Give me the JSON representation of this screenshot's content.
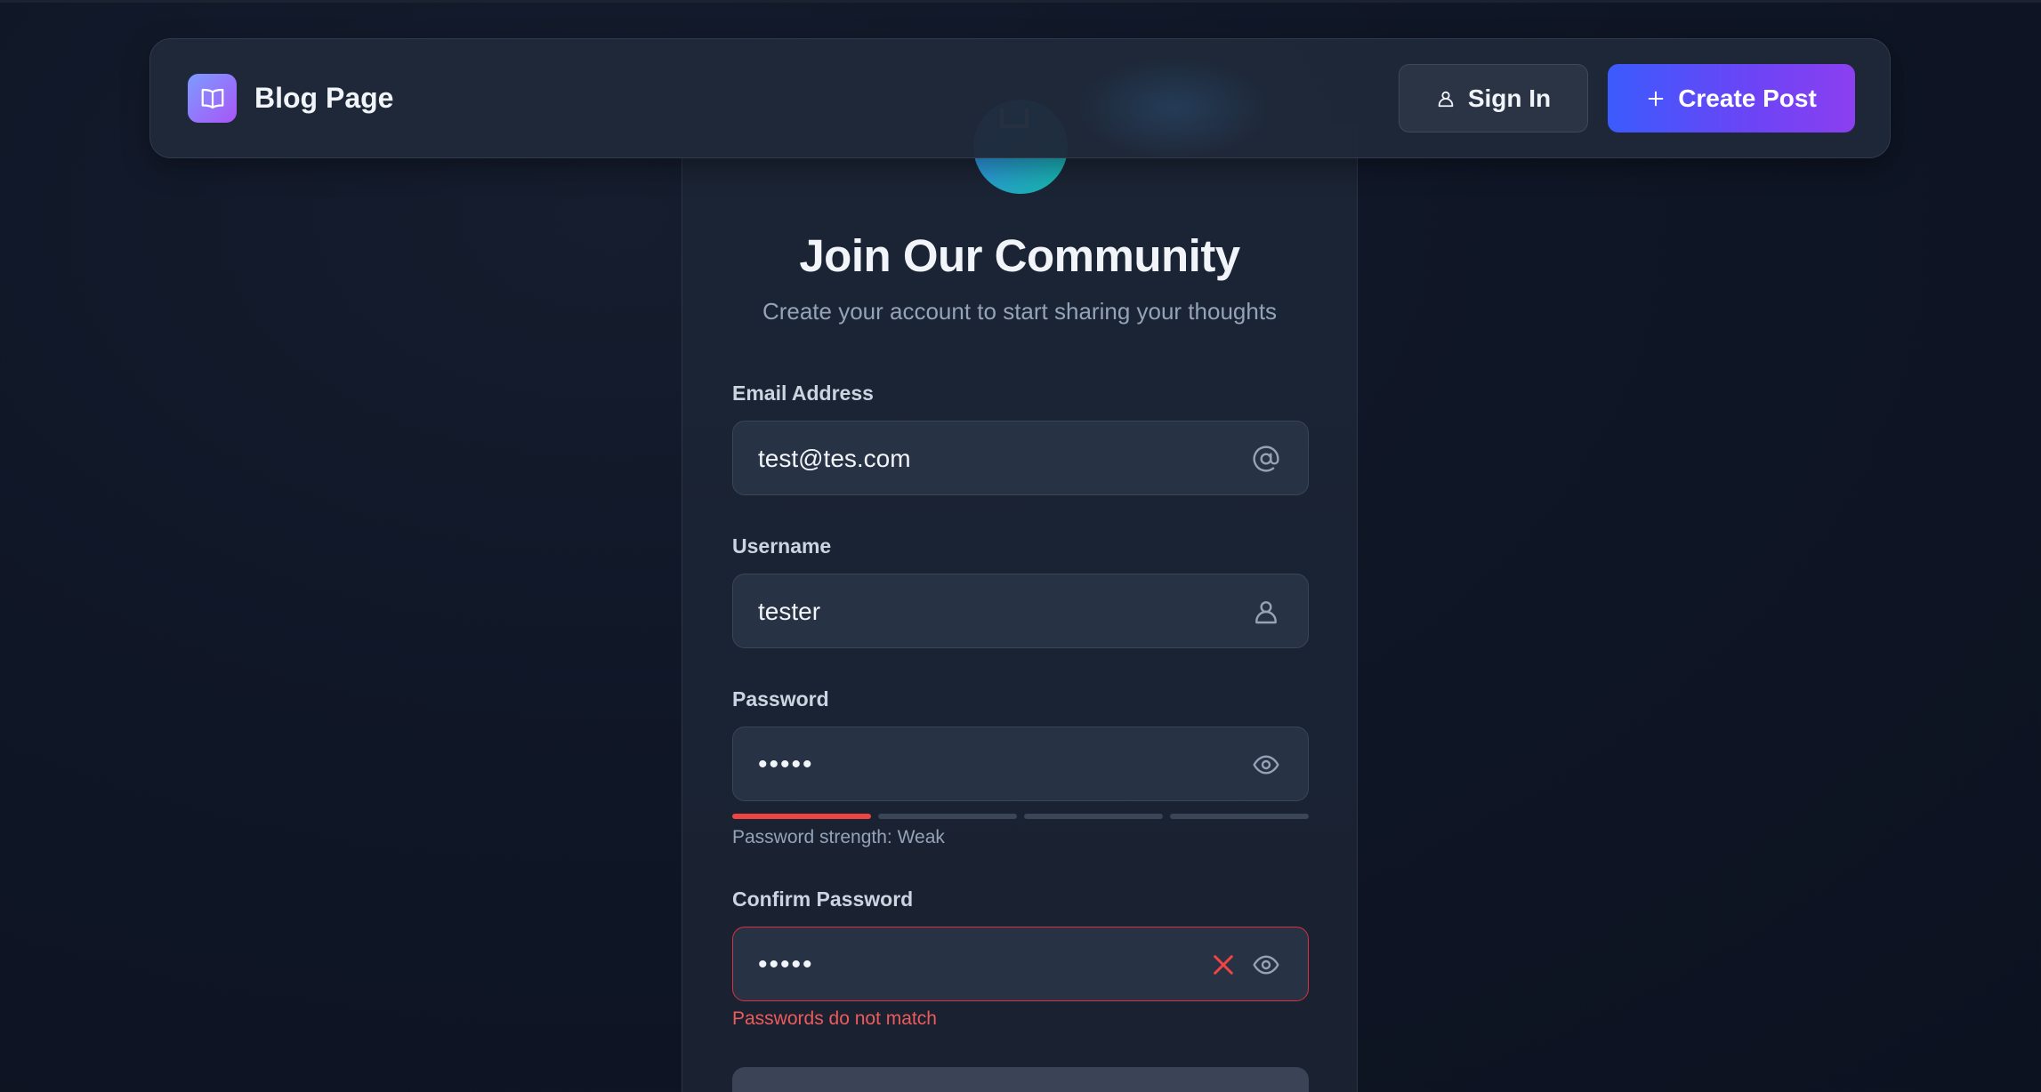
{
  "header": {
    "brand": "Blog Page",
    "sign_in_label": "Sign In",
    "create_post_label": "Create Post"
  },
  "form": {
    "title": "Join Our Community",
    "subtitle": "Create your account to start sharing your thoughts",
    "email": {
      "label": "Email Address",
      "value": "test@tes.com",
      "icon": "at-sign-icon"
    },
    "username": {
      "label": "Username",
      "value": "tester",
      "icon": "user-icon"
    },
    "password": {
      "label": "Password",
      "value": "•••••",
      "icon": "eye-icon",
      "strength_text": "Password strength: Weak",
      "strength_level": 1,
      "strength_max": 4
    },
    "confirm_password": {
      "label": "Confirm Password",
      "value": "•••••",
      "icon": "eye-icon",
      "status_icon": "x-icon",
      "error": "Passwords do not match"
    }
  },
  "colors": {
    "accent_start": "#3b5bfd",
    "accent_end": "#8b3ff0",
    "error": "#ef4444",
    "background": "#0f1626"
  }
}
